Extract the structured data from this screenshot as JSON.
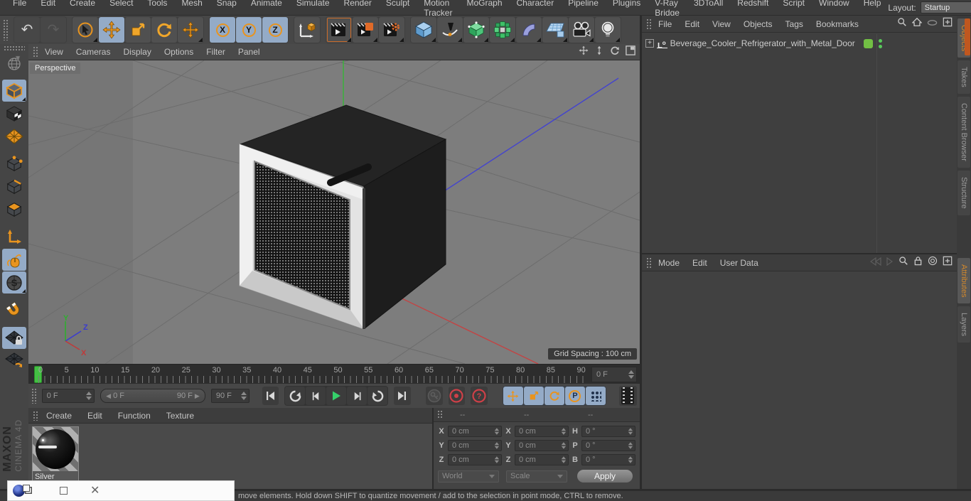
{
  "menubar": {
    "items": [
      "File",
      "Edit",
      "Create",
      "Select",
      "Tools",
      "Mesh",
      "Snap",
      "Animate",
      "Simulate",
      "Render",
      "Sculpt",
      "Motion Tracker",
      "MoGraph",
      "Character",
      "Pipeline",
      "Plugins",
      "V-Ray Bridge",
      "3DToAll",
      "Redshift",
      "Script",
      "Window",
      "Help"
    ],
    "layout_label": "Layout:",
    "layout_value": "Startup"
  },
  "toolbar": {
    "axis_buttons": [
      "X",
      "Y",
      "Z"
    ]
  },
  "left_toolbar": {
    "snap_letter": "S"
  },
  "viewport": {
    "menu": [
      "View",
      "Cameras",
      "Display",
      "Options",
      "Filter",
      "Panel"
    ],
    "camera_label": "Perspective",
    "grid_spacing_label": "Grid Spacing : 100 cm",
    "axis_labels": {
      "x": "X",
      "y": "Y",
      "z": "Z"
    }
  },
  "timeline": {
    "ticks": [
      "0",
      "5",
      "10",
      "15",
      "20",
      "25",
      "30",
      "35",
      "40",
      "45",
      "50",
      "55",
      "60",
      "65",
      "70",
      "75",
      "80",
      "85",
      "90"
    ],
    "frame_field": "0 F"
  },
  "transport": {
    "start_field": "0 F",
    "end_field": "90 F",
    "range_start": "0 F",
    "range_end": "90 F",
    "arrow_left": "◀",
    "arrow_right": "▶",
    "help_label": "?",
    "parameter_label": "P"
  },
  "materials": {
    "menu": [
      "Create",
      "Edit",
      "Function",
      "Texture"
    ],
    "items": [
      {
        "name": "Silver"
      }
    ]
  },
  "coordinates": {
    "headers": [
      "--",
      "--",
      "--"
    ],
    "rows": [
      {
        "a_label": "X",
        "a_value": "0 cm",
        "b_label": "X",
        "b_value": "0 cm",
        "c_label": "H",
        "c_value": "0 °"
      },
      {
        "a_label": "Y",
        "a_value": "0 cm",
        "b_label": "Y",
        "b_value": "0 cm",
        "c_label": "P",
        "c_value": "0 °"
      },
      {
        "a_label": "Z",
        "a_value": "0 cm",
        "b_label": "Z",
        "b_value": "0 cm",
        "c_label": "B",
        "c_value": "0 °"
      }
    ],
    "system_dropdown": "World",
    "mode_dropdown": "Scale",
    "apply_label": "Apply"
  },
  "object_manager": {
    "menu": [
      "File",
      "Edit",
      "View",
      "Objects",
      "Tags",
      "Bookmarks"
    ],
    "objects": [
      {
        "name": "Beverage_Cooler_Refrigerator_with_Metal_Door"
      }
    ]
  },
  "attribute_manager": {
    "menu": [
      "Mode",
      "Edit",
      "User Data"
    ]
  },
  "right_tabs": {
    "top": [
      {
        "label": "Objects",
        "state": "active"
      },
      {
        "label": "Takes"
      },
      {
        "label": "Content Browser"
      },
      {
        "label": "Structure"
      }
    ],
    "bottom": [
      {
        "label": "Attributes",
        "state": "active"
      },
      {
        "label": "Layers"
      }
    ]
  },
  "status_bar": {
    "text": "move elements. Hold down SHIFT to quantize movement / add to the selection in point mode, CTRL to remove."
  },
  "branding": {
    "line1": "MAXON",
    "line2": "CINEMA 4D"
  },
  "colors": {
    "accent_orange": "#e8941f",
    "highlight_blue": "#94abc7",
    "timeline_green": "#43c043",
    "record_red": "#cf4048",
    "viewport_gray": "#7d7d7d"
  }
}
